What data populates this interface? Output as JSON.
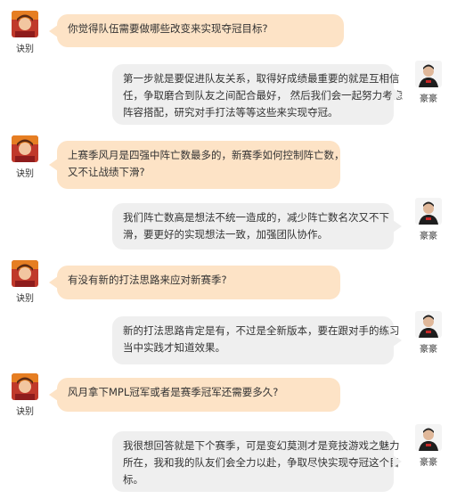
{
  "speakers": {
    "interviewer": {
      "name": "诀别",
      "avatar_icon": "game-character-avatar-icon"
    },
    "player": {
      "name": "豪豪",
      "avatar_icon": "player-photo-avatar-icon"
    }
  },
  "colors": {
    "question_bubble": "#fde3c6",
    "answer_bubble": "#efefef"
  },
  "messages": [
    {
      "role": "question",
      "lines": [
        "你觉得队伍需要做哪些改变来实现夺冠目标?"
      ]
    },
    {
      "role": "answer",
      "lines": [
        "第一步就是要促进队友关系，取得好成绩最重要的就是互相信",
        "任，争取磨合到队友之间配合最好， 然后我们会一起努力考虑",
        "阵容搭配，研究对手打法等等这些来实现夺冠。"
      ]
    },
    {
      "role": "question",
      "lines": [
        "上赛季风月是四强中阵亡数最多的，新赛季如何控制阵亡数，",
        "又不让战绩下滑?"
      ]
    },
    {
      "role": "answer",
      "lines": [
        "我们阵亡数高是想法不统一造成的，减少阵亡数名次又不下",
        "滑，要更好的实现想法一致，加强团队协作。"
      ]
    },
    {
      "role": "question",
      "lines": [
        "有没有新的打法思路来应对新赛季?"
      ]
    },
    {
      "role": "answer",
      "lines": [
        "新的打法思路肯定是有，不过是全新版本，要在跟对手的练习",
        "当中实践才知道效果。"
      ]
    },
    {
      "role": "question",
      "lines": [
        "风月拿下MPL冠军或者是赛季冠军还需要多久?"
      ]
    },
    {
      "role": "answer",
      "lines": [
        "我很想回答就是下个赛季，可是变幻莫测才是竞技游戏之魅力",
        "所在，我和我的队友们会全力以赴，争取尽快实现夺冠这个目",
        "标。"
      ]
    }
  ]
}
